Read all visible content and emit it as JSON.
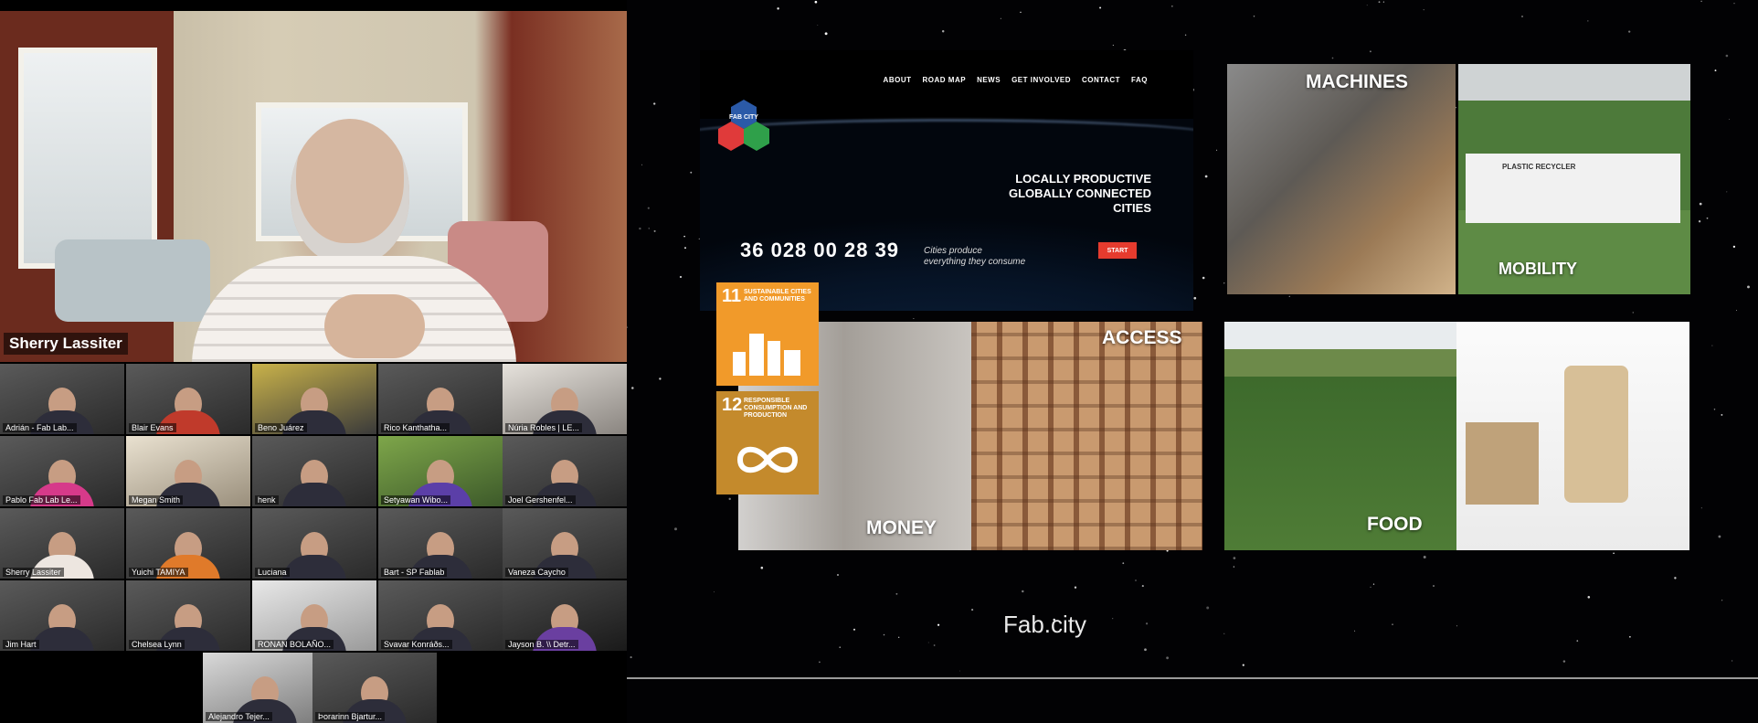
{
  "speaker": {
    "name": "Sherry Lassiter"
  },
  "participants": [
    "Adrián - Fab Lab...",
    "Blair Evans",
    "Beno Juárez",
    "Rico Kanthatha...",
    "Núria Robles | LE...",
    "Pablo Fab Lab Le...",
    "Megan Smith",
    "henk",
    "Setyawan Wibo...",
    "Joel Gershenfel...",
    "Sherry Lassiter",
    "Yuichi TAMIYA",
    "Luciana",
    "Bart - SP Fablab",
    "Vaneza Caycho",
    "Jim Hart",
    "Chelsea Lynn",
    "RONAN BOLAÑO...",
    "Svavar Konráðs...",
    "Jayson B. \\\\ Detr...",
    "Alejandro Tejer...",
    "Þorarinn Bjartur..."
  ],
  "slide": {
    "site": {
      "nav": [
        "ABOUT",
        "ROAD MAP",
        "NEWS",
        "GET INVOLVED",
        "CONTACT",
        "FAQ"
      ],
      "logo_text": "FAB CITY",
      "headline": [
        "LOCALLY PRODUCTIVE",
        "GLOBALLY CONNECTED",
        "CITIES"
      ],
      "counter": "36 028 00 28 39",
      "counter_sub": [
        "Cities produce",
        "everything they consume"
      ],
      "start_label": "START"
    },
    "sdg": [
      {
        "number": "11",
        "text": "Sustainable cities and communities",
        "color": "#f19a2a"
      },
      {
        "number": "12",
        "text": "Responsible consumption and production",
        "color": "#c48a2c"
      }
    ],
    "captions": {
      "machines": "MACHINES",
      "mobility": "MOBILITY",
      "access": "ACCESS",
      "money": "MONEY",
      "food": "FOOD"
    },
    "truck_text": "PLASTIC RECYCLER",
    "footer": "Fab.city"
  }
}
